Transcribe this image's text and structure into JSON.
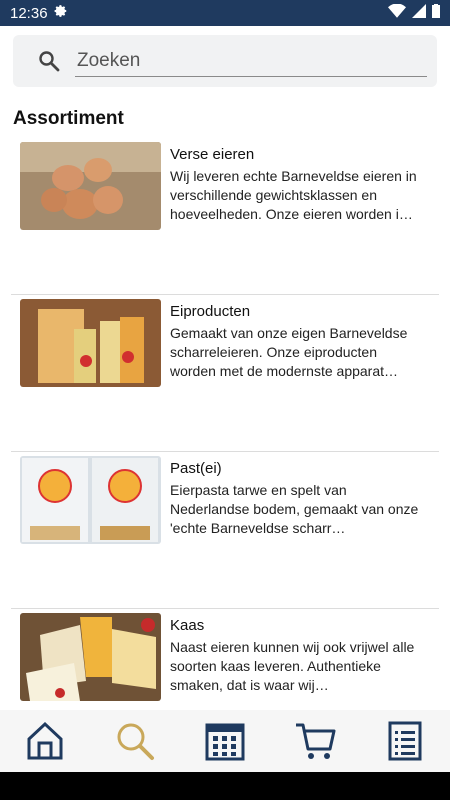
{
  "status_bar": {
    "time": "12:36"
  },
  "search": {
    "placeholder": "Zoeken"
  },
  "section_title": "Assortiment",
  "items": [
    {
      "title": "Verse eieren",
      "description": "Wij leveren echte Barneveldse eieren in verschillende gewichtsklassen en hoeveelheden. Onze eieren worden i…"
    },
    {
      "title": "Eiproducten",
      "description": "Gemaakt van onze eigen Barneveldse scharreleieren. Onze eiproducten worden met de modernste apparat…"
    },
    {
      "title": "Past(ei)",
      "description": "Eierpasta tarwe en spelt van Nederlandse bodem, gemaakt van onze 'echte Barneveldse scharr…"
    },
    {
      "title": "Kaas",
      "description": "Naast eieren kunnen wij ook vrijwel alle soorten kaas leveren. Authentieke smaken, dat is waar wij…"
    }
  ],
  "nav": {
    "icons": [
      "home-icon",
      "search-icon",
      "calendar-icon",
      "cart-icon",
      "list-icon"
    ],
    "active": "search-icon",
    "colors": {
      "primary": "#1f3a5f",
      "active": "#c9a85a"
    }
  }
}
